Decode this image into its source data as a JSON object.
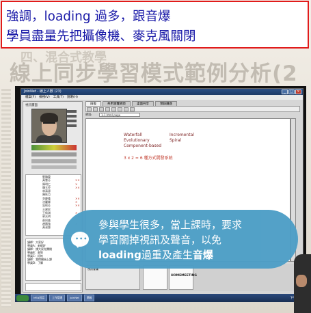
{
  "caption": {
    "line1": "強調，loading 過多，跟音爆",
    "line2": "學員盡量先把攝像機、麥克風關閉"
  },
  "slide": {
    "subtitle": "四、混合式教學",
    "title": "線上同步學習模式範例分析(2"
  },
  "app": {
    "window_title": "JoinNet - 線上人數 (23)",
    "menu": [
      "檔案(F)",
      "檢視(V)",
      "工具(T)",
      "說明(H)"
    ],
    "tabs": [
      "白板",
      "共用瀏覽網頁",
      "桌面共享",
      "預錄講座"
    ],
    "address_label": "網址",
    "address_value": "1-1.html.page",
    "panel_label": "視訊畫面",
    "users": [
      "劉鎮榮",
      "黃慧芳",
      "陳明仁",
      "羅玉芬",
      "林清源",
      "陳秋月",
      "李慶隆",
      "沈麗卿",
      "吳佩芳",
      "王建民",
      "王佩琪",
      "郭光明",
      "蔡阿美",
      "趙國強",
      "黃淑惠"
    ],
    "chat": [
      "講師：大家好",
      "學員A：老師好",
      "講師：請大家先關閉",
      "學員B：收到",
      "學員C：好的",
      "講師：我們開始上課",
      "學員D：了解"
    ],
    "doc_lines": [
      {
        "left": "Waterfall",
        "right": "Incremental"
      },
      {
        "left": "Evolutionary",
        "right": "Spiral"
      },
      {
        "left": "Component-based",
        "right": ""
      }
    ],
    "doc_formula": "3 x 2 = 6 種方式開發系統",
    "media_label": "視訊會議",
    "thumb_logo": "HOMEMEETING",
    "taskbar_items": [
      "MSN對話",
      "工作管理",
      "JoinNet",
      "簡報"
    ],
    "clock": "下午 03:45"
  },
  "bubble": {
    "line1": "參與學生很多，當上課時，要求",
    "line2": "學習關掉視訊及聲音，以免",
    "line3_bold1": "loading",
    "line3_mid": "過重及產生",
    "line3_bold2": "音爆"
  },
  "colors": {
    "caption_border": "#e11b1b",
    "caption_text": "#1a1aa8",
    "bubble_bg": "#4d9ec6"
  }
}
